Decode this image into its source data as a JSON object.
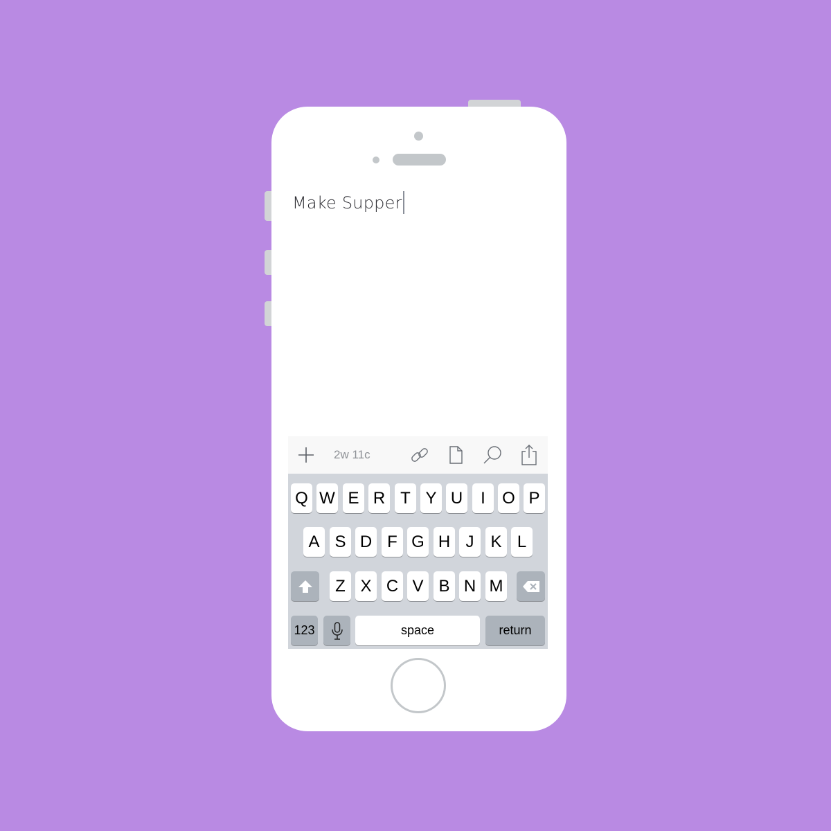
{
  "note": {
    "text": "Make Supper"
  },
  "toolbar": {
    "word_count": "2w 11c",
    "icons": [
      "plus-icon",
      "link-icon",
      "document-icon",
      "search-icon",
      "share-icon"
    ]
  },
  "keyboard": {
    "row1": [
      "Q",
      "W",
      "E",
      "R",
      "T",
      "Y",
      "U",
      "I",
      "O",
      "P"
    ],
    "row2": [
      "A",
      "S",
      "D",
      "F",
      "G",
      "H",
      "J",
      "K",
      "L"
    ],
    "row3": [
      "Z",
      "X",
      "C",
      "V",
      "B",
      "N",
      "M"
    ],
    "numbers_label": "123",
    "space_label": "space",
    "return_label": "return"
  },
  "colors": {
    "background": "#b98ae3",
    "keyboard_bg": "#d1d5db",
    "function_key": "#acb3bb"
  }
}
